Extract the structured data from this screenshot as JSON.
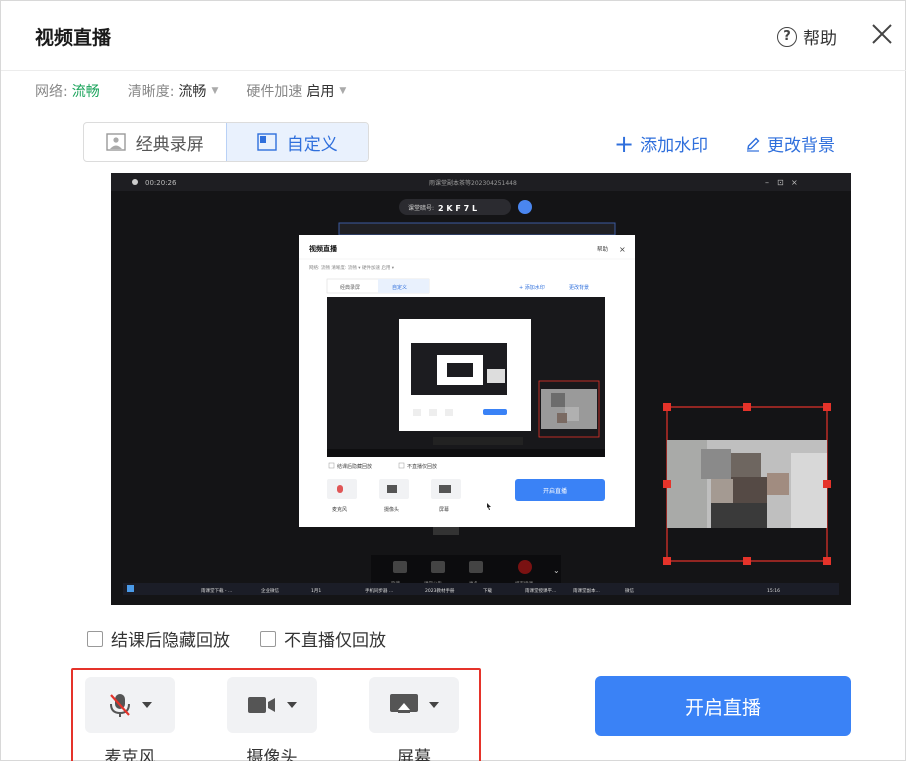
{
  "window": {
    "title": "视频直播"
  },
  "header": {
    "help_label": "帮助",
    "help_glyph": "?"
  },
  "settings": {
    "network_label": "网络:",
    "network_value": "流畅",
    "clarity_label": "清晰度:",
    "clarity_value": "流畅",
    "hw_label": "硬件加速",
    "hw_value": "启用"
  },
  "mode": {
    "classic_label": "经典录屏",
    "custom_label": "自定义",
    "selected": "自定义"
  },
  "actions": {
    "add_watermark_label": "添加水印",
    "change_bg_label": "更改背景"
  },
  "preview": {
    "timer": "00:20:26",
    "window_title": "雨课堂副本茶等202304251448",
    "classroom_code_label": "课堂暗号:",
    "classroom_code": "2 K F 7 L",
    "inner_dialog": {
      "title": "视频直播",
      "help_label": "帮助",
      "settings_text": "网络: 流畅    清晰度: 流畅 ▾    硬件加速 启用 ▾",
      "classic_label": "经典录屏",
      "custom_label": "自定义",
      "add_watermark_label": "+ 添加水印",
      "change_bg_label": "更改背景",
      "check1": "结课后隐藏回放",
      "check2": "不直播仅回放",
      "mic_label": "麦克风",
      "camera_label": "摄像头",
      "screen_label": "屏幕",
      "start_label": "开启直播"
    },
    "toolbar_labels": [
      "隐藏",
      "课堂公告",
      "更多",
      "结束授课"
    ],
    "taskbar_items": [
      "雨课堂下载 - ...",
      "企业微信",
      "1月1",
      "手机同步器 ...",
      "2023教材手册",
      "下载",
      "雨课堂授课平...",
      "雨课堂副本...",
      "微信"
    ],
    "taskbar_time": "15:16"
  },
  "options": {
    "hide_replay_label": "结课后隐藏回放",
    "replay_only_label": "不直播仅回放"
  },
  "devices": {
    "mic_label": "麦克风",
    "camera_label": "摄像头",
    "screen_label": "屏幕"
  },
  "start_button_label": "开启直播",
  "colors": {
    "accent": "#3a82f6",
    "link": "#2f6fdc",
    "good": "#19a35a",
    "highlight": "#e5332a"
  }
}
